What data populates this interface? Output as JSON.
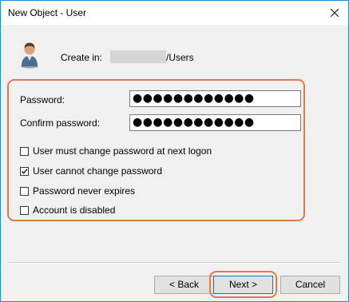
{
  "window": {
    "title": "New Object - User"
  },
  "header": {
    "create_label": "Create in:",
    "create_path": "/Users"
  },
  "fields": {
    "password_label": "Password:",
    "password_value": "●●●●●●●●●●●●",
    "confirm_label": "Confirm password:",
    "confirm_value": "●●●●●●●●●●●●"
  },
  "options": [
    {
      "label": "User must change password at next logon",
      "checked": false
    },
    {
      "label": "User cannot change password",
      "checked": true
    },
    {
      "label": "Password never expires",
      "checked": false
    },
    {
      "label": "Account is disabled",
      "checked": false
    }
  ],
  "buttons": {
    "back": "< Back",
    "next": "Next >",
    "cancel": "Cancel"
  },
  "colors": {
    "highlight": "#e0794a",
    "window_border": "#1a8fd9",
    "accent": "#0078d7"
  }
}
